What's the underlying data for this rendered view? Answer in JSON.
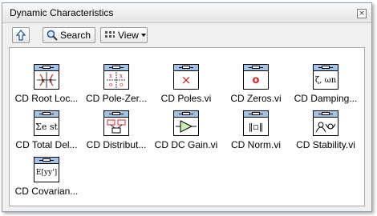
{
  "window": {
    "title": "Dynamic Characteristics",
    "close_glyph": "×"
  },
  "toolbar": {
    "search_label": "Search",
    "view_label": "View"
  },
  "items": [
    {
      "label": "CD Root Loc...",
      "icon": "root-locus-icon"
    },
    {
      "label": "CD Pole-Zer...",
      "icon": "pole-zero-map-icon"
    },
    {
      "label": "CD Poles.vi",
      "icon": "poles-icon",
      "glyph": "×"
    },
    {
      "label": "CD Zeros.vi",
      "icon": "zeros-icon",
      "glyph": "o"
    },
    {
      "label": "CD Damping...",
      "icon": "damping-icon",
      "glyph": "ζ, ωn"
    },
    {
      "label": "CD Total Del...",
      "icon": "total-delay-icon",
      "glyph": "Σe st"
    },
    {
      "label": "CD Distribut...",
      "icon": "distribute-delay-icon"
    },
    {
      "label": "CD DC Gain.vi",
      "icon": "dc-gain-icon"
    },
    {
      "label": "CD Norm.vi",
      "icon": "norm-icon",
      "glyph": "‖▫‖"
    },
    {
      "label": "CD Stability.vi",
      "icon": "stability-icon"
    },
    {
      "label": "CD Covarian...",
      "icon": "covariance-icon",
      "glyph": "E[yy']"
    }
  ]
}
